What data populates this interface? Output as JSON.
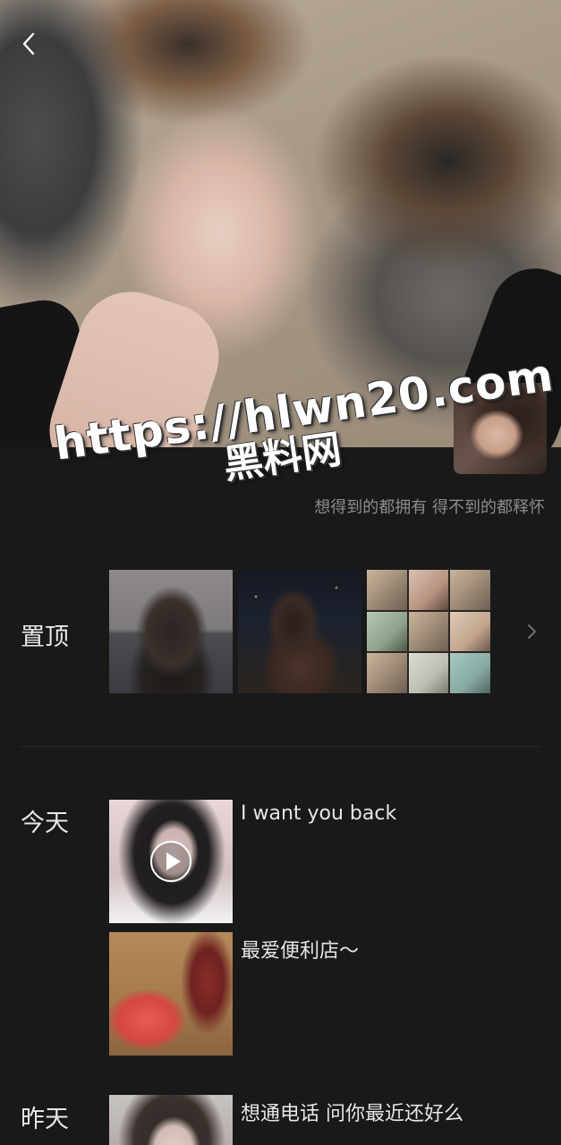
{
  "profile": {
    "signature": "想得到的都拥有 得不到的都释怀"
  },
  "watermark": {
    "url": "https://hlwn20.com",
    "name": "黑料网"
  },
  "icons": {
    "back": "chevron-left-icon",
    "more": "chevron-right-icon",
    "play": "play-icon"
  },
  "pinned": {
    "label": "置顶"
  },
  "sections": [
    {
      "label": "今天",
      "posts": [
        {
          "text": "I want you back",
          "media": "video"
        },
        {
          "text": "最爱便利店～",
          "media": "photo"
        }
      ]
    },
    {
      "label": "昨天",
      "posts": [
        {
          "text": "想通电话 问你最近还好么",
          "media": "video"
        }
      ]
    }
  ]
}
